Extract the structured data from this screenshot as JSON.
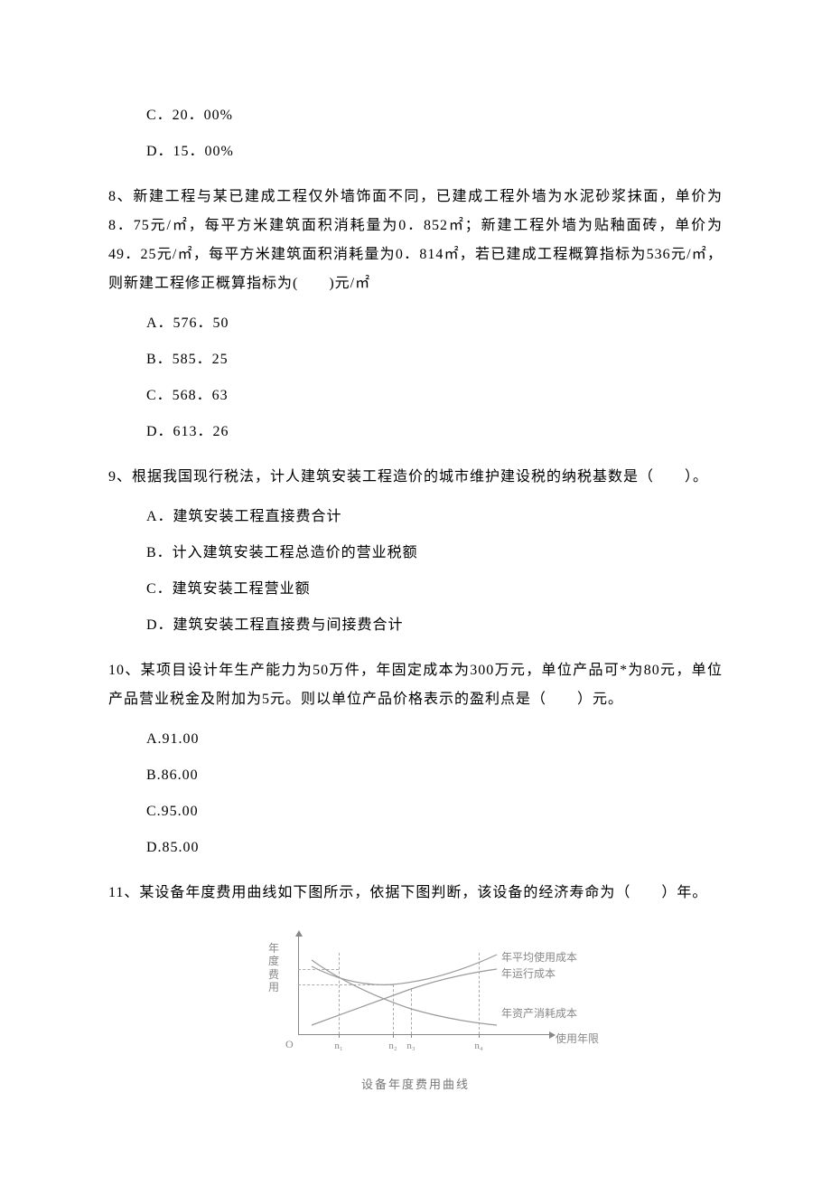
{
  "q7": {
    "optC": "C．20．00%",
    "optD": "D．15．00%"
  },
  "q8": {
    "stem": "8、新建工程与某已建成工程仅外墙饰面不同，已建成工程外墙为水泥砂浆抹面，单价为8．75元/㎡，每平方米建筑面积消耗量为0．852㎡；新建工程外墙为贴釉面砖，单价为49．25元/㎡，每平方米建筑面积消耗量为0．814㎡，若已建成工程概算指标为536元/㎡，则新建工程修正概算指标为(　　)元/㎡",
    "optA": "A．576．50",
    "optB": "B．585．25",
    "optC": "C．568．63",
    "optD": "D．613．26"
  },
  "q9": {
    "stem": "9、根据我国现行税法，计人建筑安装工程造价的城市维护建设税的纳税基数是（　　）。",
    "optA": "A．建筑安装工程直接费合计",
    "optB": "B．计入建筑安装工程总造价的营业税额",
    "optC": "C．建筑安装工程营业额",
    "optD": "D．建筑安装工程直接费与间接费合计"
  },
  "q10": {
    "stem": "10、某项目设计年生产能力为50万件，年固定成本为300万元，单位产品可*为80元，单位产品营业税金及附加为5元。则以单位产品价格表示的盈利点是（　　）元。",
    "optA": "A.91.00",
    "optB": "B.86.00",
    "optC": "C.95.00",
    "optD": "D.85.00"
  },
  "q11": {
    "stem": "11、某设备年度费用曲线如下图所示，依据下图判断，该设备的经济寿命为（　　）年。",
    "figure": {
      "ylabel": "年度费用",
      "xlabel": "使用年限",
      "origin": "O",
      "ticks": [
        "n₁",
        "n₂",
        "n₃",
        "n₄"
      ],
      "legend1": "年平均使用成本",
      "legend2": "年运行成本",
      "legend3": "年资产消耗成本",
      "caption": "设备年度费用曲线"
    }
  }
}
